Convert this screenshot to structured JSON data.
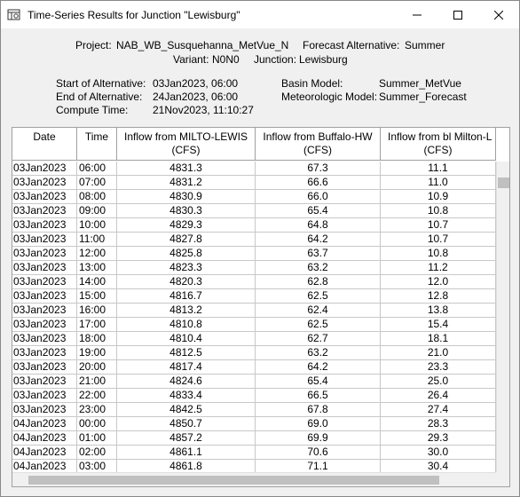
{
  "window": {
    "title": "Time-Series Results for Junction \"Lewisburg\""
  },
  "header_info": {
    "project_label": "Project:",
    "project_value": "NAB_WB_Susquehanna_MetVue_N",
    "forecast_alt_label": "Forecast Alternative:",
    "forecast_alt_value": "Summer",
    "variant_label": "Variant:",
    "variant_value": "N0N0",
    "junction_label": "Junction:",
    "junction_value": "Lewisburg",
    "start_label": "Start of Alternative:",
    "start_value": "03Jan2023, 06:00",
    "end_label": "End of Alternative:",
    "end_value": "24Jan2023, 06:00",
    "compute_label": "Compute Time:",
    "compute_value": "21Nov2023, 11:10:27",
    "basin_label": "Basin Model:",
    "basin_value": "Summer_MetVue",
    "met_label": "Meteorologic Model:",
    "met_value": "Summer_Forecast"
  },
  "table": {
    "columns": [
      {
        "line1": "Date",
        "line2": ""
      },
      {
        "line1": "Time",
        "line2": ""
      },
      {
        "line1": "Inflow from MILTO-LEWIS",
        "line2": "(CFS)"
      },
      {
        "line1": "Inflow from Buffalo-HW",
        "line2": "(CFS)"
      },
      {
        "line1": "Inflow from bl Milton-L",
        "line2": "(CFS)"
      }
    ],
    "rows": [
      [
        "03Jan2023",
        "06:00",
        "4831.3",
        "67.3",
        "11.1"
      ],
      [
        "03Jan2023",
        "07:00",
        "4831.2",
        "66.6",
        "11.0"
      ],
      [
        "03Jan2023",
        "08:00",
        "4830.9",
        "66.0",
        "10.9"
      ],
      [
        "03Jan2023",
        "09:00",
        "4830.3",
        "65.4",
        "10.8"
      ],
      [
        "03Jan2023",
        "10:00",
        "4829.3",
        "64.8",
        "10.7"
      ],
      [
        "03Jan2023",
        "11:00",
        "4827.8",
        "64.2",
        "10.7"
      ],
      [
        "03Jan2023",
        "12:00",
        "4825.8",
        "63.7",
        "10.8"
      ],
      [
        "03Jan2023",
        "13:00",
        "4823.3",
        "63.2",
        "11.2"
      ],
      [
        "03Jan2023",
        "14:00",
        "4820.3",
        "62.8",
        "12.0"
      ],
      [
        "03Jan2023",
        "15:00",
        "4816.7",
        "62.5",
        "12.8"
      ],
      [
        "03Jan2023",
        "16:00",
        "4813.2",
        "62.4",
        "13.8"
      ],
      [
        "03Jan2023",
        "17:00",
        "4810.8",
        "62.5",
        "15.4"
      ],
      [
        "03Jan2023",
        "18:00",
        "4810.4",
        "62.7",
        "18.1"
      ],
      [
        "03Jan2023",
        "19:00",
        "4812.5",
        "63.2",
        "21.0"
      ],
      [
        "03Jan2023",
        "20:00",
        "4817.4",
        "64.2",
        "23.3"
      ],
      [
        "03Jan2023",
        "21:00",
        "4824.6",
        "65.4",
        "25.0"
      ],
      [
        "03Jan2023",
        "22:00",
        "4833.4",
        "66.5",
        "26.4"
      ],
      [
        "03Jan2023",
        "23:00",
        "4842.5",
        "67.8",
        "27.4"
      ],
      [
        "04Jan2023",
        "00:00",
        "4850.7",
        "69.0",
        "28.3"
      ],
      [
        "04Jan2023",
        "01:00",
        "4857.2",
        "69.9",
        "29.3"
      ],
      [
        "04Jan2023",
        "02:00",
        "4861.1",
        "70.6",
        "30.0"
      ],
      [
        "04Jan2023",
        "03:00",
        "4861.8",
        "71.1",
        "30.4"
      ]
    ]
  },
  "colors": {
    "background": "#f0f0f0",
    "grid_background": "#ffffff",
    "scroll_thumb": "#c0c0c0"
  }
}
